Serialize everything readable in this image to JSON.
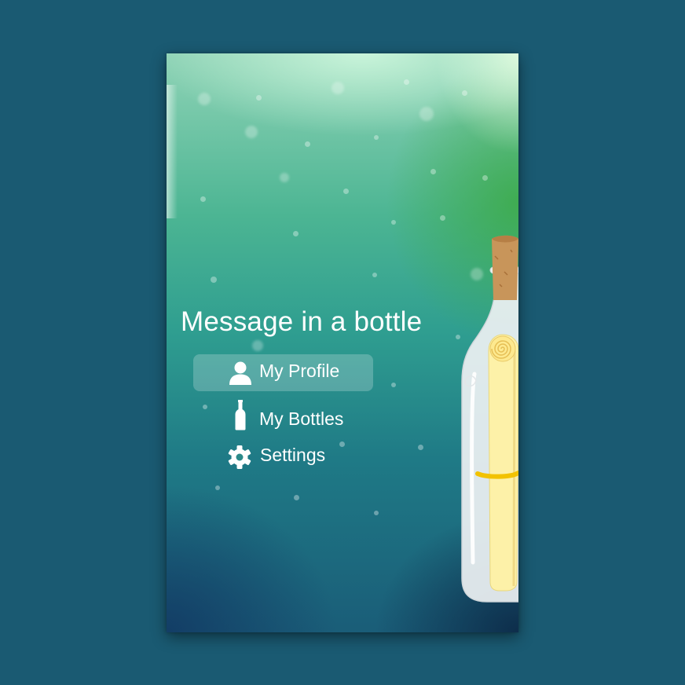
{
  "app": {
    "title": "Message in a bottle"
  },
  "menu": {
    "items": [
      {
        "label": "My Profile",
        "icon": "person-icon",
        "active": true
      },
      {
        "label": "My Bottles",
        "icon": "bottle-icon",
        "active": false
      },
      {
        "label": "Settings",
        "icon": "gear-icon",
        "active": false
      }
    ]
  },
  "colors": {
    "page_background": "#1a5a72",
    "text": "#ffffff",
    "active_highlight": "rgba(255,255,255,0.22)",
    "cork": "#c8955a",
    "scroll": "#fdf1a8",
    "scroll_band": "#f2c200"
  }
}
